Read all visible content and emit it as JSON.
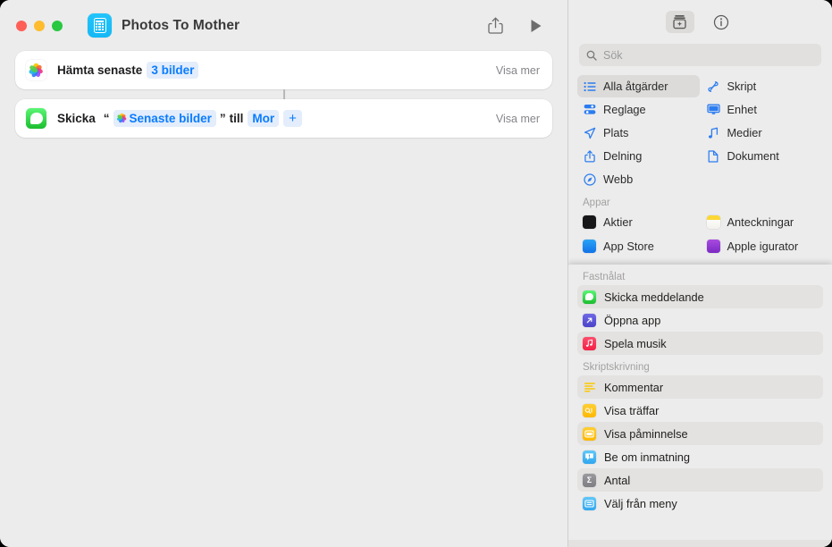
{
  "window": {
    "title": "Photos To Mother",
    "app_icon": "shortcuts-calculator-icon",
    "traffic_lights": [
      "close",
      "minimize",
      "zoom"
    ],
    "toolbar": {
      "share_label": "share-icon",
      "play_label": "play-icon"
    }
  },
  "workflow": {
    "actions": [
      {
        "icon": "photos-icon",
        "prefix": "Hämta senaste",
        "token": "3 bilder",
        "show_more": "Visa mer"
      },
      {
        "icon": "messages-icon",
        "prefix": "Skicka",
        "open_quote": "“",
        "token": "Senaste bilder",
        "close_quote": "”",
        "middle": "till",
        "token2": "Mor",
        "plus": "+",
        "show_more": "Visa mer"
      }
    ]
  },
  "sidebar": {
    "toolbar": {
      "action_library_label": "action-library-icon",
      "info_label": "info-icon"
    },
    "search": {
      "placeholder": "Sök",
      "value": "",
      "icon": "search-icon"
    },
    "categories": [
      {
        "label": "Alla åtgärder",
        "icon": "list-bullet-icon",
        "selected": true
      },
      {
        "label": "Skript",
        "icon": "script-icon",
        "selected": false
      },
      {
        "label": "Reglage",
        "icon": "sliders-icon",
        "selected": false
      },
      {
        "label": "Enhet",
        "icon": "display-icon",
        "selected": false
      },
      {
        "label": "Plats",
        "icon": "location-arrow-icon",
        "selected": false
      },
      {
        "label": "Medier",
        "icon": "music-note-icon",
        "selected": false
      },
      {
        "label": "Delning",
        "icon": "share-icon",
        "selected": false
      },
      {
        "label": "Dokument",
        "icon": "document-icon",
        "selected": false
      },
      {
        "label": "Webb",
        "icon": "safari-compass-icon",
        "selected": false
      }
    ],
    "apps_section": {
      "title": "Appar",
      "apps": [
        {
          "label": "Aktier",
          "icon": "stocks-app-icon",
          "color": "#1c1c1e"
        },
        {
          "label": "Anteckningar",
          "icon": "notes-app-icon",
          "color": "#f8e71c"
        },
        {
          "label": "App Store",
          "icon": "app-store-icon",
          "color": "#1d8cf5"
        },
        {
          "label": "Apple  igurator",
          "icon": "apple-configurator-icon",
          "color": "#8e3fd4"
        }
      ]
    },
    "library": {
      "pinned_section": {
        "title": "Fastnålat",
        "items": [
          {
            "label": "Skicka meddelande",
            "icon": "messages-icon",
            "color": "#32d74b",
            "alt": true
          },
          {
            "label": "Öppna app",
            "icon": "open-app-icon",
            "color": "#5b55d8",
            "alt": false
          },
          {
            "label": "Spela musik",
            "icon": "music-app-icon",
            "color": "#fb2c54",
            "alt": true
          }
        ]
      },
      "scripting_section": {
        "title": "Skriptskrivning",
        "items": [
          {
            "label": "Kommentar",
            "icon": "comment-lines-icon",
            "color": "#ffffff",
            "alt": true
          },
          {
            "label": "Visa träffar",
            "icon": "show-result-icon",
            "color": "#ffc300",
            "alt": false
          },
          {
            "label": "Visa påminnelse",
            "icon": "show-alert-icon",
            "color": "#ffc300",
            "alt": true
          },
          {
            "label": "Be om inmatning",
            "icon": "ask-input-icon",
            "color": "#4ab8f5",
            "alt": false
          },
          {
            "label": "Antal",
            "icon": "count-sigma-icon",
            "color": "#8e8e93",
            "alt": true
          },
          {
            "label": "Välj från meny",
            "icon": "choose-menu-icon",
            "color": "#4ab8f5",
            "alt": false
          }
        ]
      }
    }
  },
  "colors": {
    "accent_blue": "#0a7cff",
    "token_bg": "#e3edfb",
    "window_bg": "#ececec",
    "card_bg": "#ffffff",
    "selected_row": "#dcdbda"
  }
}
